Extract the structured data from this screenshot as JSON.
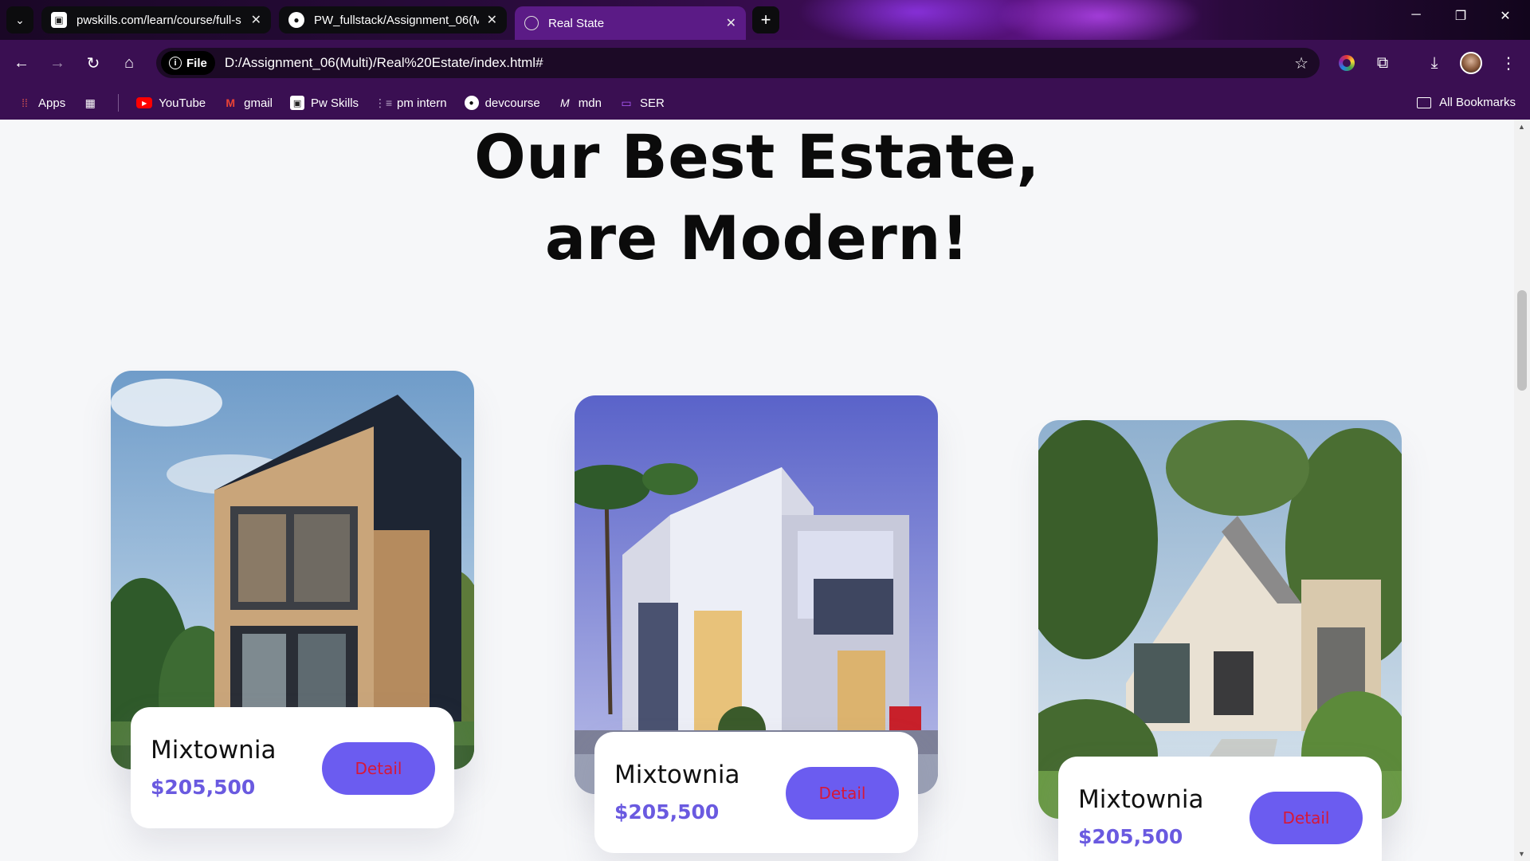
{
  "browser": {
    "tabs": [
      {
        "title": "pwskills.com/learn/course/full-s",
        "active": false
      },
      {
        "title": "PW_fullstack/Assignment_06(M",
        "active": false
      },
      {
        "title": "Real State",
        "active": true
      }
    ],
    "address": {
      "chip": "File",
      "url": "D:/Assignment_06(Multi)/Real%20Estate/index.html#"
    },
    "bookmarks": [
      {
        "label": "Apps",
        "icon": "apps-grid-icon"
      },
      {
        "label": "YouTube",
        "icon": "youtube-icon"
      },
      {
        "label": "gmail",
        "icon": "gmail-icon"
      },
      {
        "label": "Pw Skills",
        "icon": "pwskills-icon"
      },
      {
        "label": "pm intern",
        "icon": "pm-intern-icon"
      },
      {
        "label": "devcourse",
        "icon": "github-icon"
      },
      {
        "label": "mdn",
        "icon": "mdn-icon"
      },
      {
        "label": "SER",
        "icon": "ser-icon"
      }
    ],
    "all_bookmarks": "All Bookmarks"
  },
  "page": {
    "heading_line1": "Our Best Estate,",
    "heading_line2": "are Modern!",
    "cards": [
      {
        "name": "Mixtownia",
        "price": "$205,500",
        "button": "Detail"
      },
      {
        "name": "Mixtownia",
        "price": "$205,500",
        "button": "Detail"
      },
      {
        "name": "Mixtownia",
        "price": "$205,500",
        "button": "Detail"
      }
    ]
  },
  "colors": {
    "accent": "#6b5cf0",
    "price": "#6a5ae0",
    "button_text": "#d61838",
    "chrome": "#3a0f52"
  }
}
